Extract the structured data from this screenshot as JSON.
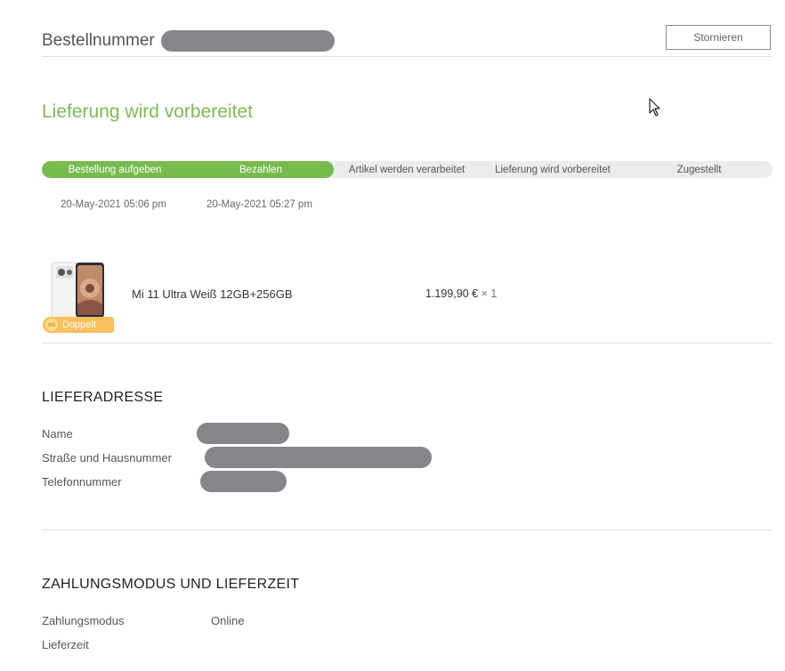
{
  "header": {
    "order_number_label": "Bestellnummer",
    "cancel_button_label": "Stornieren"
  },
  "status": {
    "title": "Lieferung wird vorbereitet"
  },
  "progress": {
    "fraction_complete": 0.4,
    "steps": [
      {
        "label": "Bestellung aufgeben",
        "done": true
      },
      {
        "label": "Bezahlen",
        "done": true
      },
      {
        "label": "Artikel werden verarbeitet",
        "done": false
      },
      {
        "label": "Lieferung wird vorbereitet",
        "done": false
      },
      {
        "label": "Zugestellt",
        "done": false
      }
    ],
    "dates": [
      "20-May-2021 05:06 pm",
      "20-May-2021 05:27 pm"
    ]
  },
  "product": {
    "badge_icon": "mi-logo-icon",
    "badge_label": "Doppelt",
    "name": "Mi 11 Ultra Weiß 12GB+256GB",
    "price": "1.199,90 €",
    "quantity": "× 1"
  },
  "delivery_address": {
    "heading": "LIEFERADRESSE",
    "name_label": "Name",
    "street_label": "Straße und Hausnummer",
    "phone_label": "Telefonnummer"
  },
  "payment": {
    "heading": "ZAHLUNGSMODUS UND LIEFERZEIT",
    "mode_label": "Zahlungsmodus",
    "mode_value": "Online",
    "delivery_time_label": "Lieferzeit"
  },
  "colors": {
    "accent_green": "#77bb4d",
    "badge_orange": "#f8bf5e",
    "redaction_gray": "#85858a"
  }
}
